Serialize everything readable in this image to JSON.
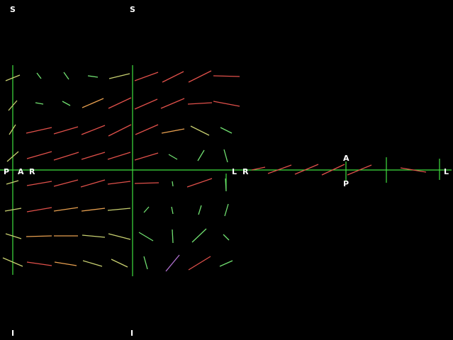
{
  "viewer": {
    "title": "",
    "left_view": {
      "top_labels": [
        "S",
        "S"
      ],
      "bottom_labels": [
        "I",
        "I"
      ],
      "axis_labels": {
        "left_p": "P",
        "left_a": "A",
        "left_r": "R",
        "right_l": "L"
      }
    },
    "right_view": {
      "axis_labels": {
        "left_r": "R",
        "top_a": "A",
        "bottom_p": "P",
        "right_l": "L"
      }
    },
    "colors": {
      "background": "#000000",
      "crosshair": "#3fe03f",
      "label": "#ffffff",
      "fiber_red": "#e0504a",
      "fiber_orange": "#e8a050",
      "fiber_yellow": "#c8d070",
      "fiber_green": "#70e070",
      "fiber_purple": "#b070d0"
    }
  }
}
